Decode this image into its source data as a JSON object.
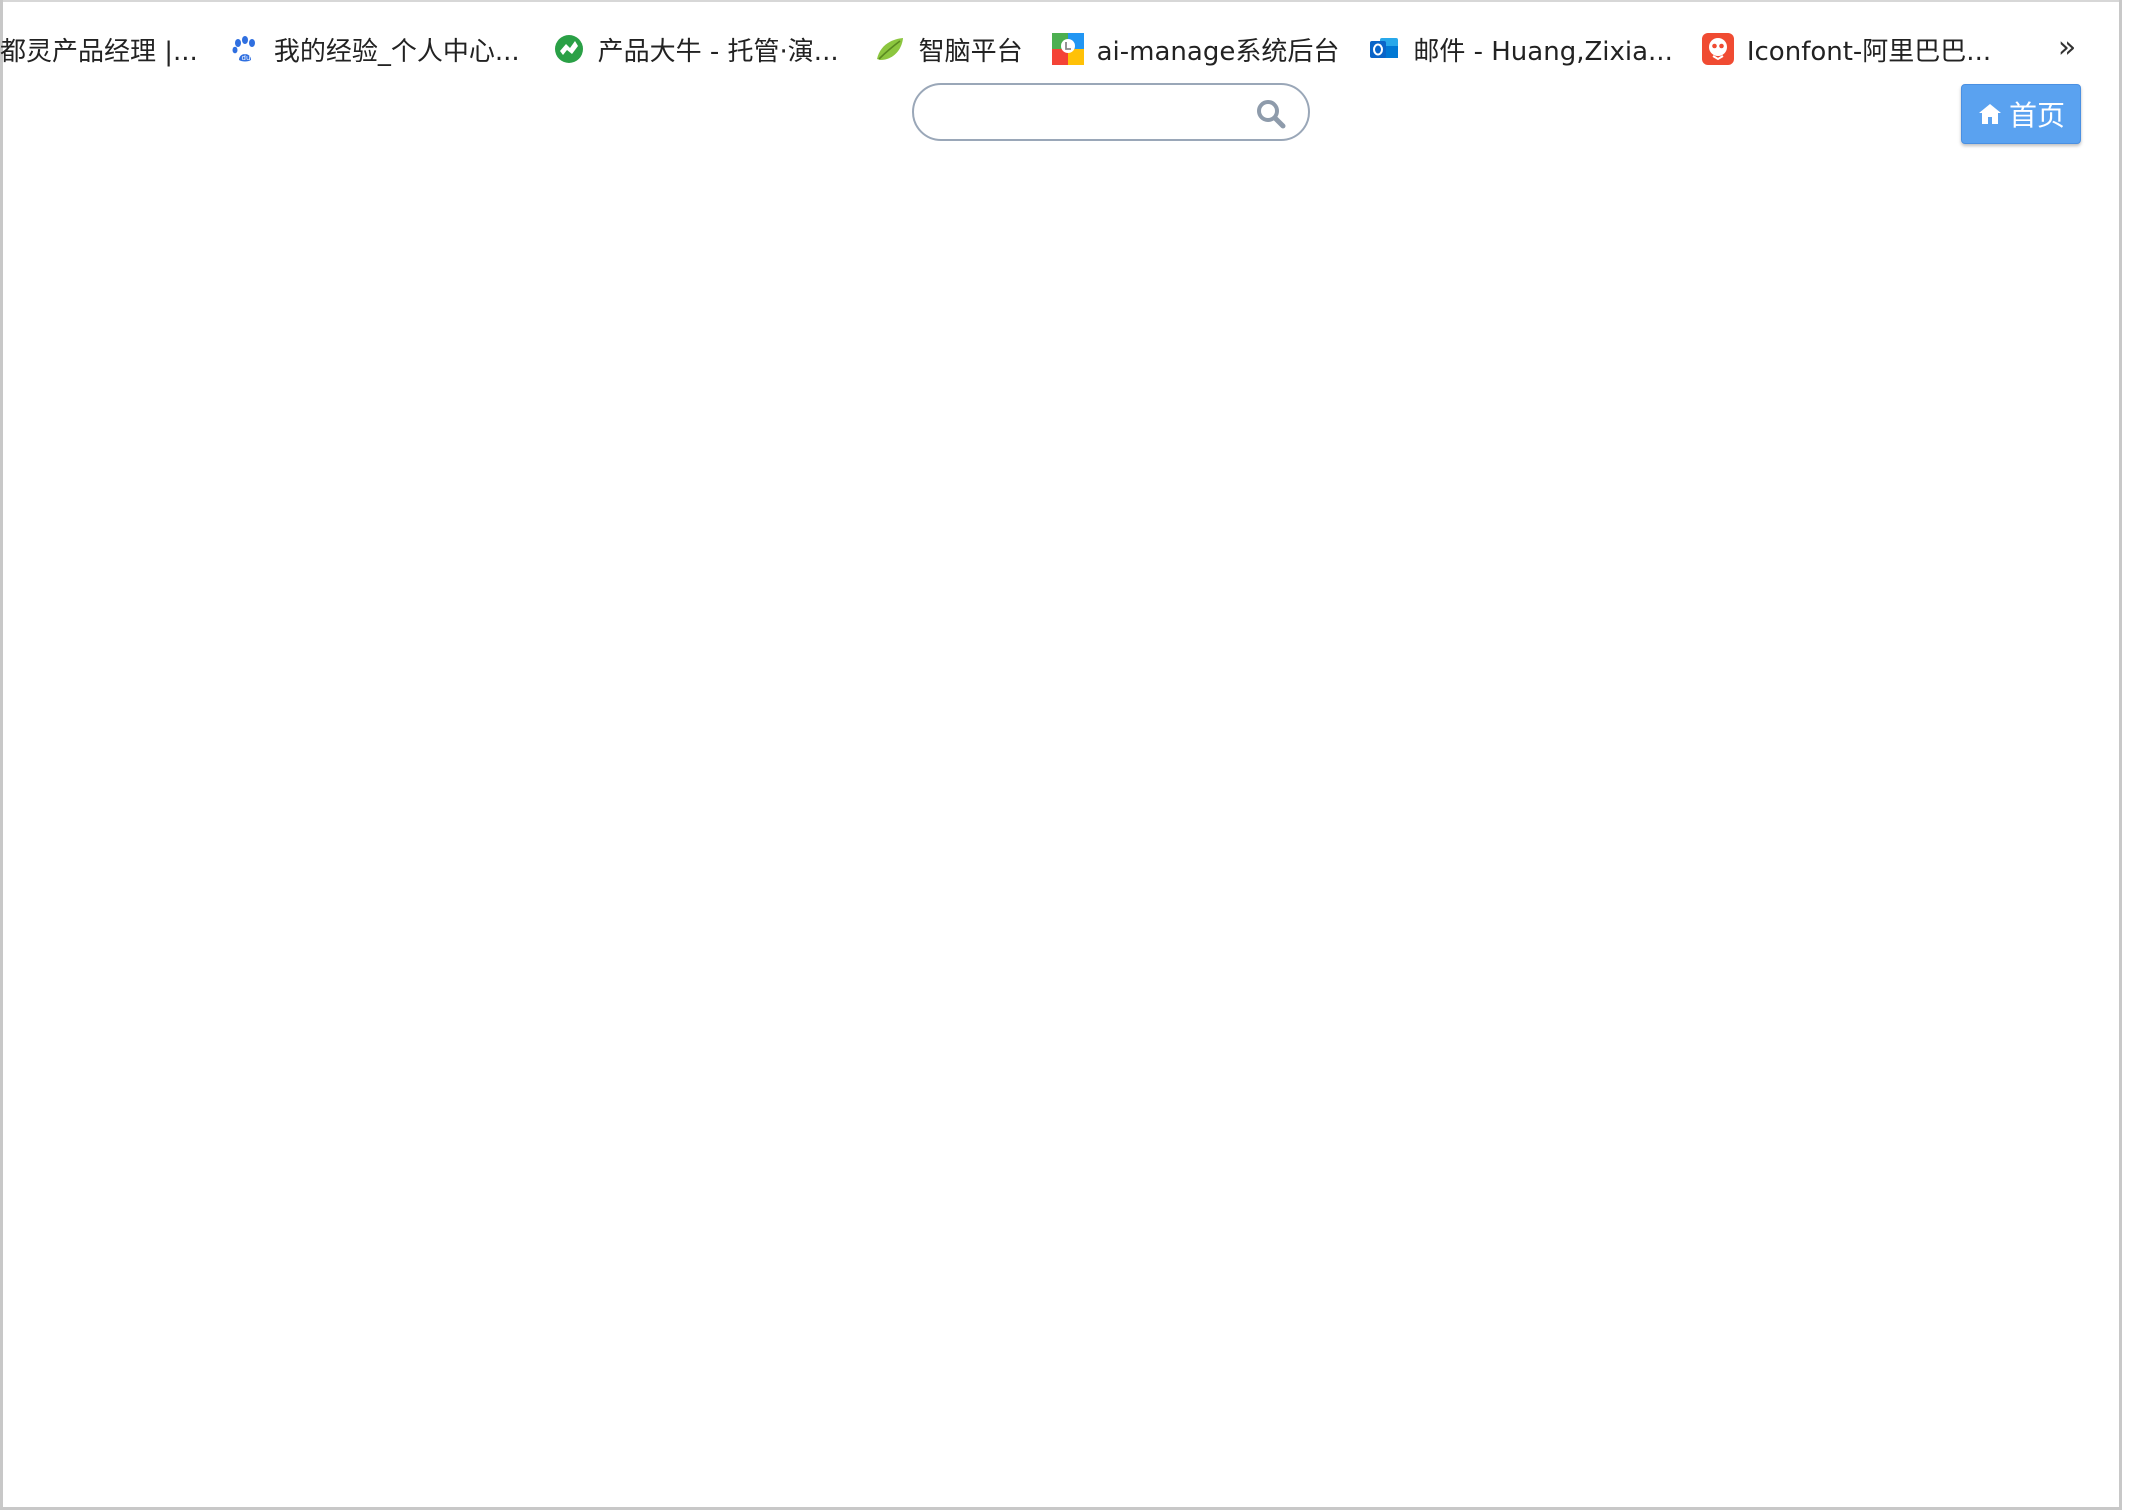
{
  "bookmarks_bar": {
    "items": [
      {
        "label": "都灵产品经理 |...",
        "icon": "none"
      },
      {
        "label": "我的经验_个人中心...",
        "icon": "baidu-paw-icon"
      },
      {
        "label": "产品大牛 - 托管·演...",
        "icon": "rhino-logo-icon"
      },
      {
        "label": "智脑平台",
        "icon": "leaf-icon"
      },
      {
        "label": "ai-manage系统后台",
        "icon": "ai-manage-logo-icon"
      },
      {
        "label": "邮件 - Huang,Zixia...",
        "icon": "outlook-icon"
      },
      {
        "label": "Iconfont-阿里巴巴...",
        "icon": "iconfont-logo-icon"
      }
    ],
    "more_label": "»"
  },
  "search": {
    "value": "",
    "placeholder": "",
    "icon": "search-icon"
  },
  "home_button": {
    "label": "首页",
    "icon": "home-icon"
  },
  "colors": {
    "home_button_bg": "#5aa2f0",
    "search_border": "#9aa7b8",
    "baidu_blue": "#2f6fe0",
    "rhino_green": "#2aa046",
    "leaf_green": "#8cc63f",
    "outlook_blue": "#0a64c8",
    "iconfont_red": "#f04b32"
  }
}
